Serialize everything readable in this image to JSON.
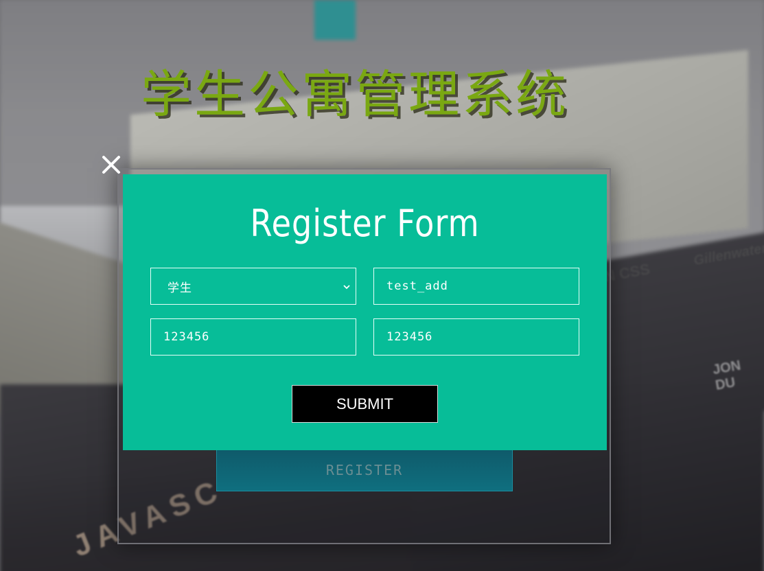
{
  "page": {
    "title": "学生公寓管理系统"
  },
  "background": {
    "text_gillenwater": "Gillenwater",
    "text_jondu": "JON DU",
    "text_javascript": "JAVASC",
    "text_css": "N CSS"
  },
  "behind": {
    "register_label": "REGISTER"
  },
  "modal": {
    "title": "Register Form",
    "role_select": {
      "value": "学生",
      "options": [
        "学生"
      ]
    },
    "username_value": "test_add",
    "password_value": "123456",
    "confirm_password_value": "123456",
    "submit_label": "SUBMIT",
    "close_icon": "close-icon"
  },
  "colors": {
    "modal_bg": "#07bd98",
    "title_color": "#7aa812",
    "submit_bg": "#000000",
    "register_bg": "#0f6f7f"
  }
}
